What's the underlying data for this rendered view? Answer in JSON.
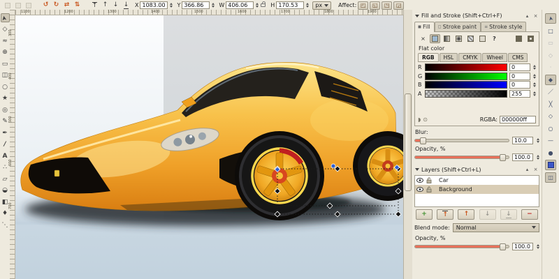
{
  "topbar": {
    "x_label": "X",
    "x_value": "1083.00",
    "y_label": "Y",
    "y_value": "366.86",
    "w_label": "W",
    "w_value": "406.06",
    "h_label": "H",
    "h_value": "170.53",
    "unit": "px",
    "affect_label": "Affect:"
  },
  "glyphs": {
    "rotate_ccw": "↺",
    "rotate_cw": "↻",
    "flip_h": "⇄",
    "flip_v": "⇅",
    "raise": "↑",
    "lower": "↓",
    "none": "×",
    "unknown": "?"
  },
  "rulers": {
    "h": [
      "1100",
      "1200",
      "1300",
      "1400",
      "1500",
      "1600",
      "1700",
      "1800",
      "1900"
    ],
    "v": [
      "300",
      "400",
      "500",
      "600",
      "700"
    ]
  },
  "fill_stroke": {
    "title": "Fill and Stroke (Shift+Ctrl+F)",
    "tab_fill": "Fill",
    "tab_stroke_paint": "Stroke paint",
    "tab_stroke_style": "Stroke style",
    "mode_label": "Flat color",
    "color_tabs": {
      "rgb": "RGB",
      "hsl": "HSL",
      "cmyk": "CMYK",
      "wheel": "Wheel",
      "cms": "CMS"
    },
    "r_label": "R",
    "r_value": "0",
    "g_label": "G",
    "g_value": "0",
    "b_label": "B",
    "b_value": "0",
    "a_label": "A",
    "a_value": "255",
    "rgba_label": "RGBA:",
    "rgba_value": "000000ff",
    "blur_label": "Blur:",
    "blur_value": "10.0",
    "opacity_label": "Opacity, %",
    "opacity_value": "100.0"
  },
  "layers": {
    "title": "Layers (Shift+Ctrl+L)",
    "layer_1": "Car",
    "layer_2": "Background",
    "blend_label": "Blend mode:",
    "blend_value": "Normal",
    "opacity_label": "Opacity, %",
    "opacity_value": "100.0"
  },
  "colors": {
    "slider_accent": "#e8705a",
    "selected_row": "#d9cdb5",
    "canvas_floor": "#c3d2de",
    "car_body": "#f5b135",
    "slider_r_end": "#ff0000",
    "slider_g_end": "#00ff00",
    "slider_b_end": "#0000ff"
  }
}
